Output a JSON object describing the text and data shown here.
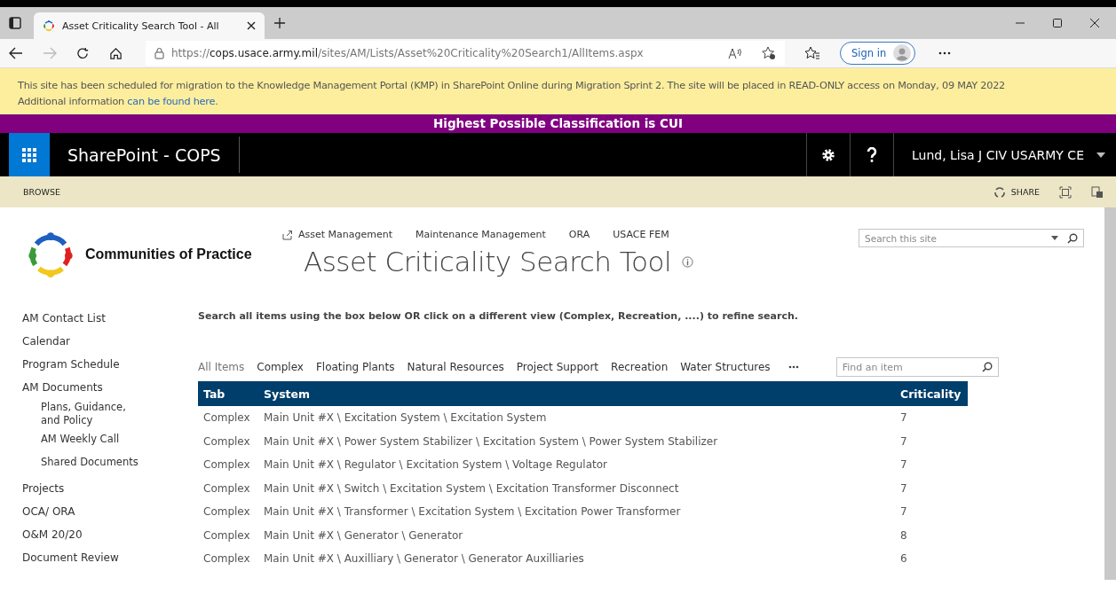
{
  "browser": {
    "tab_title": "Asset Criticality Search Tool - All",
    "url": {
      "scheme": "https://",
      "host": "cops.usace.army.mil",
      "path": "/sites/AM/Lists/Asset%20Criticality%20Search1/AllItems.aspx"
    },
    "sign_in": "Sign in"
  },
  "notice": {
    "text": "This site has been scheduled for migration to the Knowledge Management Portal (KMP) in SharePoint Online during Migration Sprint 2. The site will be placed in READ-ONLY access on Monday, 09 MAY 2022 Additional information ",
    "link": "can be found here",
    "after": "."
  },
  "classification": "Highest Possible Classification is CUI",
  "suite_bar": {
    "title": "SharePoint - COPS",
    "user": "Lund, Lisa J CIV USARMY CE"
  },
  "ribbon": {
    "tab": "BROWSE",
    "share": "SHARE"
  },
  "site": {
    "logo_text": "Communities of Practice",
    "top_nav": [
      "Asset Management",
      "Maintenance Management",
      "ORA",
      "USACE FEM"
    ],
    "title": "Asset Criticality Search Tool",
    "search": {
      "placeholder": "Search this site"
    }
  },
  "sidebar": {
    "items": [
      {
        "label": "AM Contact List"
      },
      {
        "label": "Calendar"
      },
      {
        "label": "Program Schedule"
      },
      {
        "label": "AM Documents",
        "children": [
          {
            "label": "Plans, Guidance, and Policy"
          },
          {
            "label": "AM Weekly Call"
          },
          {
            "label": "Shared Documents"
          }
        ]
      },
      {
        "label": "Projects"
      },
      {
        "label": "OCA/ ORA"
      },
      {
        "label": "O&M 20/20"
      },
      {
        "label": "Document Review"
      }
    ]
  },
  "instructions": "Search all items using the box below OR click on a different view (Complex, Recreation, ....) to refine search.",
  "views": [
    {
      "label": "All Items",
      "selected": true
    },
    {
      "label": "Complex",
      "selected": false
    },
    {
      "label": "Floating Plants",
      "selected": false
    },
    {
      "label": "Natural Resources",
      "selected": false
    },
    {
      "label": "Project Support",
      "selected": false
    },
    {
      "label": "Recreation",
      "selected": false
    },
    {
      "label": "Water Structures",
      "selected": false
    }
  ],
  "find": {
    "placeholder": "Find an item"
  },
  "table": {
    "columns": [
      "Tab",
      "System",
      "Criticality"
    ],
    "rows": [
      [
        "Complex",
        "Main Unit #X \\ Excitation System \\ Excitation System",
        "7"
      ],
      [
        "Complex",
        "Main Unit #X \\ Power System Stabilizer \\ Excitation System  \\ Power System Stabilizer",
        "7"
      ],
      [
        "Complex",
        "Main Unit #X \\ Regulator \\ Excitation System  \\ Voltage Regulator",
        "7"
      ],
      [
        "Complex",
        "Main Unit #X \\ Switch \\ Excitation System  \\ Excitation Transformer Disconnect",
        "7"
      ],
      [
        "Complex",
        "Main Unit #X \\ Transformer \\ Excitation System  \\ Excitation Power Transformer",
        "7"
      ],
      [
        "Complex",
        "Main Unit #X \\ Generator \\ Generator",
        "8"
      ],
      [
        "Complex",
        "Main Unit #X \\ Auxilliary \\ Generator  \\ Generator Auxilliaries",
        "6"
      ]
    ]
  }
}
